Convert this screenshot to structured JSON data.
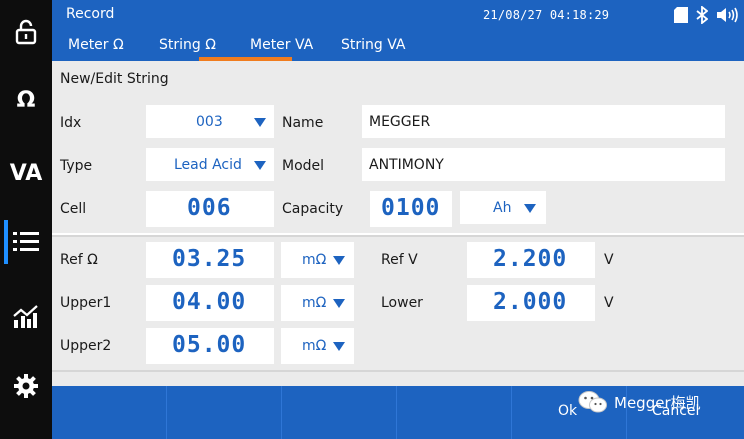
{
  "sidebar": {
    "omega_label": "Ω",
    "va_label": "VA"
  },
  "header": {
    "title": "Record",
    "datetime": "21/08/27 04:18:29"
  },
  "tabs": [
    {
      "label": "Meter Ω"
    },
    {
      "label": "String Ω"
    },
    {
      "label": "Meter VA"
    },
    {
      "label": "String VA"
    }
  ],
  "form": {
    "section_title": "New/Edit String",
    "idx": {
      "label": "Idx",
      "value": "003"
    },
    "name": {
      "label": "Name",
      "value": "MEGGER"
    },
    "type": {
      "label": "Type",
      "value": "Lead Acid"
    },
    "model": {
      "label": "Model",
      "value": "ANTIMONY"
    },
    "cell": {
      "label": "Cell",
      "value": "006"
    },
    "capacity": {
      "label": "Capacity",
      "value": "0100",
      "unit": "Ah"
    },
    "ref_ohm": {
      "label": "Ref Ω",
      "value": "03.25",
      "unit": "mΩ"
    },
    "ref_v": {
      "label": "Ref V",
      "value": "2.200",
      "unit": "V"
    },
    "upper1": {
      "label": "Upper1",
      "value": "04.00",
      "unit": "mΩ"
    },
    "lower": {
      "label": "Lower",
      "value": "2.000",
      "unit": "V"
    },
    "upper2": {
      "label": "Upper2",
      "value": "05.00",
      "unit": "mΩ"
    }
  },
  "buttons": {
    "ok_label": "Ok",
    "cancel_label": "Cancel"
  },
  "watermark": {
    "text": "Megger梅凯"
  },
  "colors": {
    "accent": "#1d63c0",
    "tab_underline": "#f07c1e",
    "sidebar_bg": "#0d0d0d",
    "panel_bg": "#ebebeb",
    "active_indicator": "#1f8fff"
  }
}
